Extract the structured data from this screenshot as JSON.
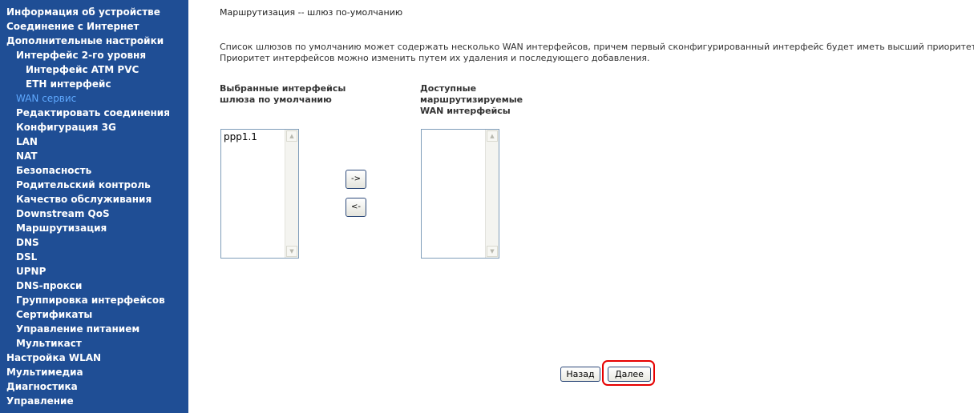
{
  "sidebar": {
    "items": [
      {
        "label": "Информация об устройстве"
      },
      {
        "label": "Соединение с Интернет"
      },
      {
        "label": "Дополнительные настройки"
      },
      {
        "label": "Интерфейс 2-го уровня"
      },
      {
        "label": "Интерфейс ATM PVC"
      },
      {
        "label": "ETH интерфейс"
      },
      {
        "label": "WAN сервис"
      },
      {
        "label": "Редактировать соединения"
      },
      {
        "label": "Конфигурация 3G"
      },
      {
        "label": "LAN"
      },
      {
        "label": "NAT"
      },
      {
        "label": "Безопасность"
      },
      {
        "label": "Родительский контроль"
      },
      {
        "label": "Качество обслуживания"
      },
      {
        "label": "Downstream QoS"
      },
      {
        "label": "Маршрутизация"
      },
      {
        "label": "DNS"
      },
      {
        "label": "DSL"
      },
      {
        "label": "UPNP"
      },
      {
        "label": "DNS-прокси"
      },
      {
        "label": "Группировка интерфейсов"
      },
      {
        "label": "Сертификаты"
      },
      {
        "label": "Управление питанием"
      },
      {
        "label": "Мультикаст"
      },
      {
        "label": "Настройка WLAN"
      },
      {
        "label": "Мультимедиа"
      },
      {
        "label": "Диагностика"
      },
      {
        "label": "Управление"
      }
    ],
    "active_item": "WAN сервис"
  },
  "main": {
    "title": "Маршрутизация -- шлюз по-умолчанию",
    "description_line1": "Список шлюзов по умолчанию может содержать несколько WAN интерфейсов, причем первый сконфигурированный интерфейс будет иметь высший приоритет.",
    "description_line2": "Приоритет интерфейсов можно изменить путем их удаления и последующего добавления.",
    "selected_label": "Выбранные интерфейсы шлюза по умолчанию",
    "available_label": "Доступные маршрутизируемые WAN интерфейсы",
    "selected_items": [
      "ppp1.1"
    ],
    "available_items": [],
    "move_right_label": "->",
    "move_left_label": "<-",
    "back_label": "Назад",
    "next_label": "Далее"
  },
  "colors": {
    "sidebar_bg": "#1f4e95",
    "active_link": "#5fa9ff",
    "highlight": "#e60000"
  }
}
